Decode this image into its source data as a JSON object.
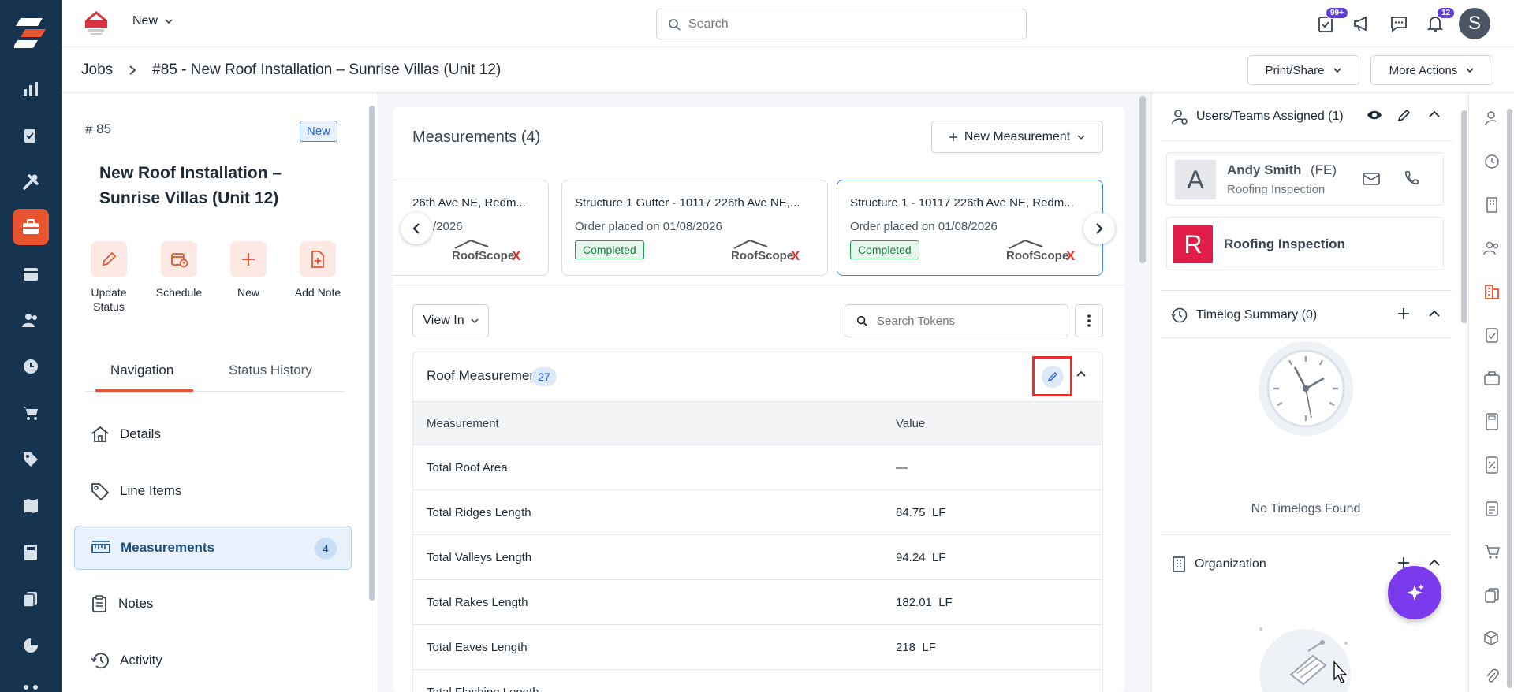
{
  "topbar": {
    "new_menu_label": "New",
    "search_placeholder": "Search",
    "tasks_badge": "99+",
    "notifications_badge": "12",
    "avatar_initial": "S"
  },
  "breadcrumb": {
    "root": "Jobs",
    "current": "#85 - New Roof Installation – Sunrise Villas (Unit 12)"
  },
  "header_actions": {
    "print_share": "Print/Share",
    "more_actions": "More Actions"
  },
  "job": {
    "number": "# 85",
    "status": "New",
    "title": "New Roof Installation – Sunrise Villas (Unit 12)",
    "actions": [
      {
        "label": "Update Status",
        "icon": "pencil-icon"
      },
      {
        "label": "Schedule",
        "icon": "calendar-clock-icon"
      },
      {
        "label": "New",
        "icon": "plus-icon"
      },
      {
        "label": "Add Note",
        "icon": "file-plus-icon"
      }
    ]
  },
  "left_tabs": {
    "navigation": "Navigation",
    "status_history": "Status History"
  },
  "nav": {
    "items": [
      {
        "label": "Details",
        "icon": "home-icon"
      },
      {
        "label": "Line Items",
        "icon": "tag-icon"
      },
      {
        "label": "Measurements",
        "icon": "ruler-icon",
        "count": "4"
      },
      {
        "label": "Notes",
        "icon": "clipboard-icon"
      },
      {
        "label": "Activity",
        "icon": "history-icon"
      }
    ]
  },
  "measurements": {
    "title": "Measurements (4)",
    "new_button": "New Measurement",
    "cards": [
      {
        "title": "26th Ave NE, Redm...",
        "date": "/2026",
        "status": ""
      },
      {
        "title": "Structure 1 Gutter - 10117 226th Ave NE,...",
        "date": "Order placed on 01/08/2026",
        "status": "Completed"
      },
      {
        "title": "Structure 1 - 10117 226th Ave NE, Redm...",
        "date": "Order placed on 01/08/2026",
        "status": "Completed"
      }
    ],
    "logo_text": "RoofScope",
    "logo_x": "X",
    "view_in": "View In",
    "search_tokens_placeholder": "Search Tokens",
    "section_title": "Roof Measurements",
    "section_count": "27",
    "columns": [
      "Measurement",
      "Value"
    ],
    "rows": [
      {
        "name": "Total Roof Area",
        "value": "—"
      },
      {
        "name": "Total Ridges Length",
        "value": "84.75  LF"
      },
      {
        "name": "Total Valleys Length",
        "value": "94.24  LF"
      },
      {
        "name": "Total Rakes Length",
        "value": "182.01  LF"
      },
      {
        "name": "Total Eaves Length",
        "value": "218  LF"
      },
      {
        "name": "Total Flashing Length",
        "value": ""
      }
    ]
  },
  "right": {
    "users_title": "Users/Teams Assigned (1)",
    "user": {
      "initial": "A",
      "name": "Andy Smith",
      "role_tag": "(FE)",
      "team": "Roofing Inspection"
    },
    "team": {
      "initial": "R",
      "name": "Roofing Inspection"
    },
    "timelog_title": "Timelog Summary (0)",
    "timelog_empty": "No Timelogs Found",
    "organization_title": "Organization"
  },
  "colors": {
    "rail": "#16344f",
    "accent": "#e8542f",
    "highlight": "#e3312f",
    "fab": "#7c3aed",
    "team_avatar": "#e11d48"
  }
}
